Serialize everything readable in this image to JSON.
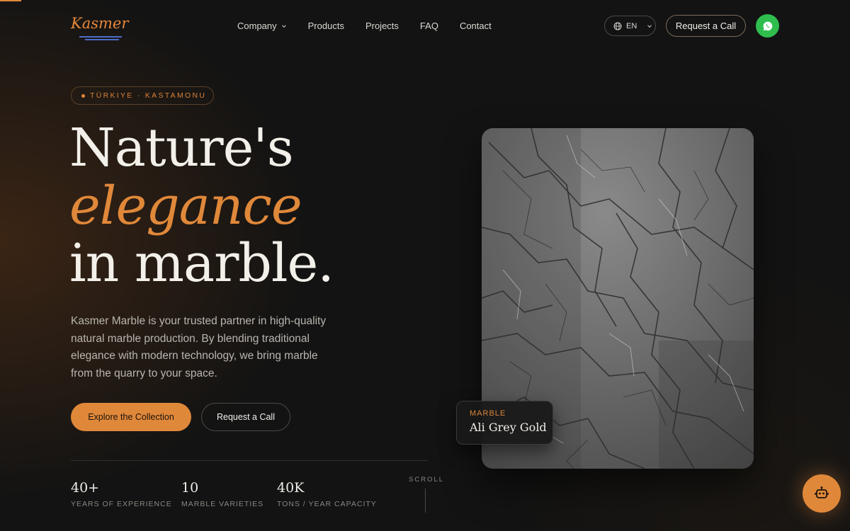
{
  "brand": {
    "logo_text": "Kasmer"
  },
  "nav": {
    "items": [
      {
        "label": "Company",
        "has_dropdown": true
      },
      {
        "label": "Products"
      },
      {
        "label": "Projects"
      },
      {
        "label": "FAQ"
      },
      {
        "label": "Contact"
      }
    ]
  },
  "header": {
    "language": "EN",
    "request_call_label": "Request a Call",
    "whatsapp_icon": "whatsapp-icon"
  },
  "hero": {
    "badge": "TÜRKIYE · KASTAMONU",
    "title_line1": "Nature's",
    "title_line2": "elegance",
    "title_line3": "in marble.",
    "description": "Kasmer Marble is your trusted partner in high-quality natural marble production. By blending traditional elegance with modern technology, we bring marble from the quarry to your space.",
    "primary_cta": "Explore the Collection",
    "secondary_cta": "Request a Call",
    "accent_color": "#e0883a"
  },
  "stats": [
    {
      "value": "40+",
      "label": "YEARS OF EXPERIENCE"
    },
    {
      "value": "10",
      "label": "MARBLE VARIETIES"
    },
    {
      "value": "40K",
      "label": "TONS / YEAR CAPACITY"
    }
  ],
  "scroll_label": "SCROLL",
  "feature": {
    "category": "MARBLE",
    "name": "Ali Grey Gold"
  },
  "chatbot_icon": "robot-icon"
}
